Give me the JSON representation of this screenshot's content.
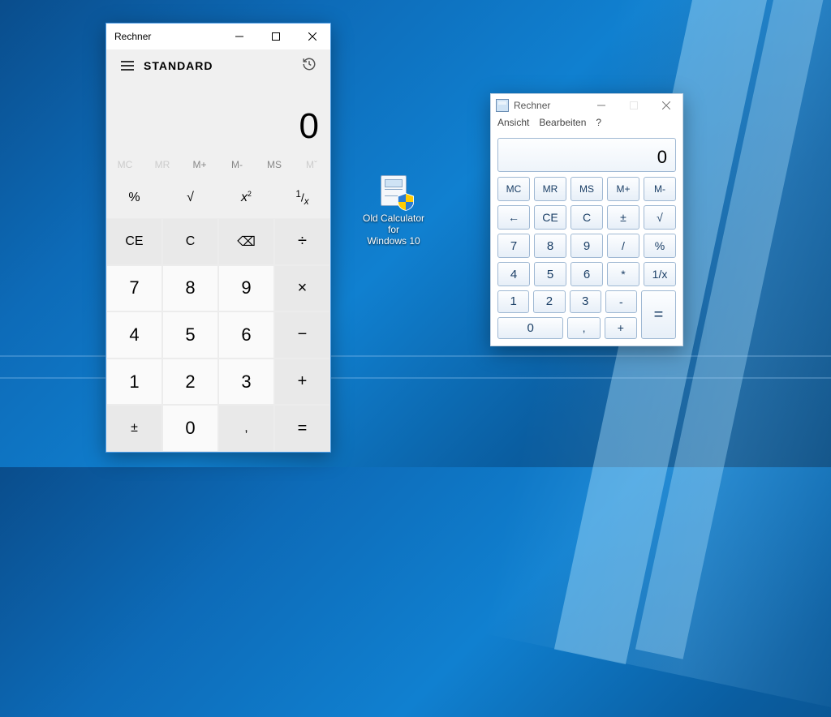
{
  "modern_calc": {
    "title": "Rechner",
    "mode": "STANDARD",
    "display": "0",
    "memory": {
      "mc": "MC",
      "mr": "MR",
      "mplus": "M+",
      "mminus": "M-",
      "ms": "MS",
      "mlist": "Mˇ"
    },
    "func": {
      "percent": "%",
      "sqrt": "√",
      "sq_base": "x",
      "sq_exp": "2",
      "recip_num": "1",
      "recip_den": "x"
    },
    "keys": {
      "ce": "CE",
      "c": "C",
      "back": "⌫",
      "div": "÷",
      "7": "7",
      "8": "8",
      "9": "9",
      "mul": "×",
      "4": "4",
      "5": "5",
      "6": "6",
      "minus": "−",
      "1": "1",
      "2": "2",
      "3": "3",
      "plus": "+",
      "negate": "±",
      "0": "0",
      "dec": ",",
      "eq": "="
    }
  },
  "desktop_icon": {
    "label_l1": "Old Calculator for",
    "label_l2": "Windows 10"
  },
  "old_calc": {
    "title": "Rechner",
    "menu": {
      "view": "Ansicht",
      "edit": "Bearbeiten",
      "help": "?"
    },
    "display": "0",
    "row_mem": {
      "mc": "MC",
      "mr": "MR",
      "ms": "MS",
      "mplus": "M+",
      "mminus": "M-"
    },
    "row1": {
      "back": "←",
      "ce": "CE",
      "c": "C",
      "neg": "±",
      "sqrt": "√"
    },
    "row2": {
      "7": "7",
      "8": "8",
      "9": "9",
      "div": "/",
      "pct": "%"
    },
    "row3": {
      "4": "4",
      "5": "5",
      "6": "6",
      "mul": "*",
      "recip": "1/x"
    },
    "row4": {
      "1": "1",
      "2": "2",
      "3": "3",
      "minus": "-"
    },
    "row5": {
      "0": "0",
      "dec": ",",
      "plus": "+"
    },
    "eq": "="
  }
}
